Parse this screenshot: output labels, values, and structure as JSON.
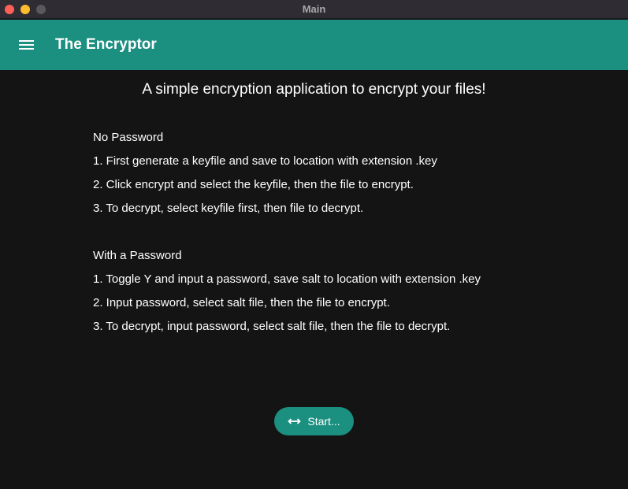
{
  "window": {
    "title": "Main"
  },
  "appbar": {
    "title": "The Encryptor",
    "menu_icon": "menu-icon"
  },
  "content": {
    "headline": "A simple encryption application to encrypt your files!",
    "no_password": {
      "heading": "No Password",
      "steps": [
        "1. First generate a keyfile and save to location with extension .key",
        "2. Click encrypt and select the keyfile, then the file to encrypt.",
        "3. To decrypt, select keyfile first, then file to decrypt."
      ]
    },
    "with_password": {
      "heading": "With a Password",
      "steps": [
        "1. Toggle Y and input a password, save salt to location with extension .key",
        "2. Input password, select salt file, then the file to encrypt.",
        "3. To decrypt, input password, select salt file, then the file to decrypt."
      ]
    },
    "start_button": {
      "label": "Start...",
      "icon": "horizontal-arrows-icon"
    }
  },
  "colors": {
    "accent": "#1b8f80",
    "background": "#141414",
    "titlebar": "#2f2d33",
    "text": "#ffffff"
  }
}
